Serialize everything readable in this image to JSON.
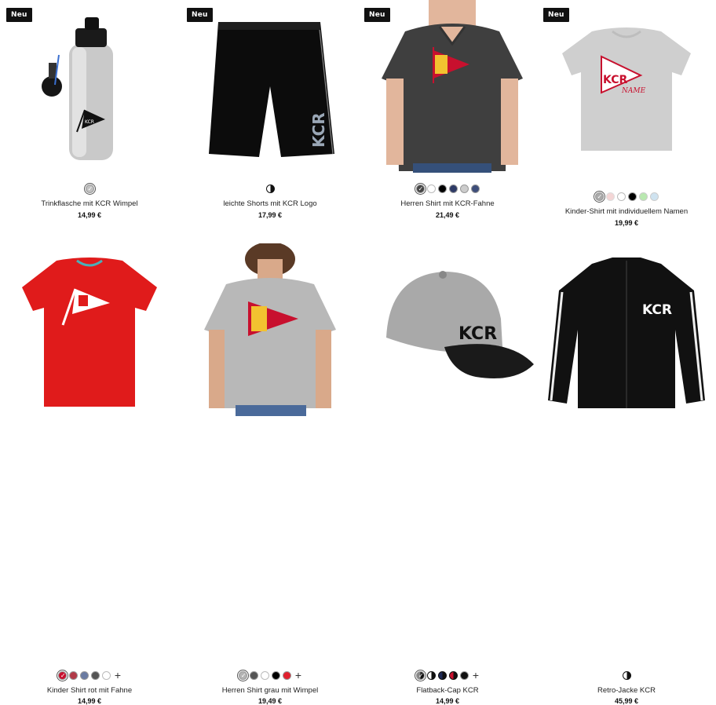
{
  "badge_label": "Neu",
  "products": [
    {
      "name": "Trinkflasche mit KCR Wimpel",
      "price": "14,99 €",
      "badge": "Neu",
      "swatches": [
        "#c0c0c0"
      ],
      "selected": 0,
      "more": false
    },
    {
      "name": "leichte Shorts mit KCR Logo",
      "price": "17,99 €",
      "badge": "Neu",
      "swatches": [
        "half-black"
      ],
      "selected": -1,
      "more": false
    },
    {
      "name": "Herren Shirt mit KCR-Fahne",
      "price": "21,49 €",
      "badge": "Neu",
      "swatches": [
        "#444444",
        "#ffffff",
        "#000000",
        "#2e3a66",
        "#cccccc",
        "#3e4e7a"
      ],
      "selected": 0,
      "more": false
    },
    {
      "name": "Kinder-Shirt mit individuellem Namen",
      "price": "19,99 €",
      "badge": "Neu",
      "swatches": [
        "#aaaaaa",
        "#f4d6d6",
        "#ffffff",
        "#000000",
        "#b9e8b0",
        "#cfe3f0"
      ],
      "selected": 0,
      "more": false
    },
    {
      "name": "Kinder Shirt rot mit Fahne",
      "price": "14,99 €",
      "badge": "",
      "swatches": [
        "#c8102e",
        "#b23a48",
        "#6a7ba2",
        "#555555",
        "#ffffff"
      ],
      "selected": 0,
      "more": true
    },
    {
      "name": "Herren Shirt grau mit Wimpel",
      "price": "19,49 €",
      "badge": "",
      "swatches": [
        "#b3b3b3",
        "#555555",
        "#ffffff",
        "#000000",
        "#e0202e"
      ],
      "selected": 0,
      "more": true
    },
    {
      "name": "Flatback-Cap KCR",
      "price": "14,99 €",
      "badge": "",
      "swatches": [
        "half-black",
        "half-black",
        "half-navy",
        "half-red",
        "#111111"
      ],
      "selected": 0,
      "more": true
    },
    {
      "name": "Retro-Jacke KCR",
      "price": "45,99 €",
      "badge": "",
      "swatches": [
        "half-black"
      ],
      "selected": -1,
      "more": false
    }
  ],
  "logo_text": "KCR",
  "name_scribble": "NAME",
  "colors": {
    "flag_red": "#c8102e",
    "flag_yellow": "#f2c230",
    "shirt_red": "#e01b1b"
  }
}
